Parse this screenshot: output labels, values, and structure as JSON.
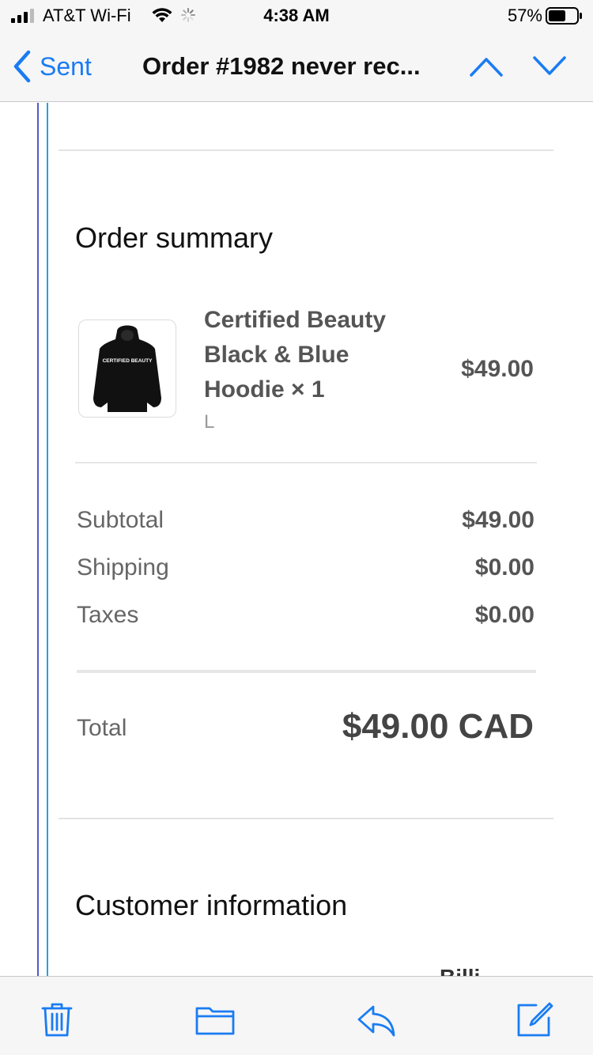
{
  "status_bar": {
    "carrier": "AT&T Wi-Fi",
    "time": "4:38 AM",
    "battery": "57%"
  },
  "nav": {
    "back_label": "Sent",
    "title": "Order #1982 never rec..."
  },
  "order_summary": {
    "title": "Order summary",
    "item": {
      "name": "Certified Beauty Black & Blue Hoodie × 1",
      "variant": "L",
      "price": "$49.00",
      "thumb_text": "CERTIFIED BEAUTY"
    },
    "rows": {
      "subtotal": {
        "label": "Subtotal",
        "value": "$49.00"
      },
      "shipping": {
        "label": "Shipping",
        "value": "$0.00"
      },
      "taxes": {
        "label": "Taxes",
        "value": "$0.00"
      }
    },
    "total": {
      "label": "Total",
      "value": "$49.00 CAD"
    }
  },
  "customer_info": {
    "title": "Customer information",
    "cut_text": "Billi"
  },
  "colors": {
    "accent": "#1a7cf2",
    "quote_bar_1": "#4e5ad0",
    "quote_bar_2": "#2aa0e0"
  },
  "toolbar_icons": [
    "trash-icon",
    "folder-icon",
    "reply-icon",
    "compose-icon"
  ]
}
